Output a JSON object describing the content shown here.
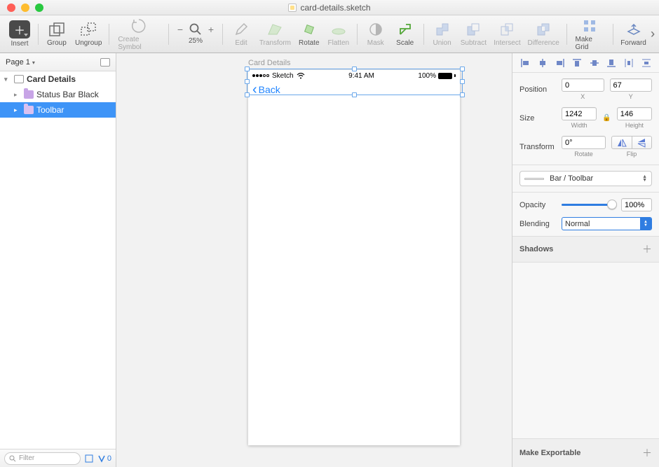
{
  "window": {
    "title": "card-details.sketch"
  },
  "toolbar": {
    "insert": "Insert",
    "group": "Group",
    "ungroup": "Ungroup",
    "create_symbol": "Create Symbol",
    "zoom_pct": "25%",
    "edit": "Edit",
    "transform": "Transform",
    "rotate": "Rotate",
    "flatten": "Flatten",
    "mask": "Mask",
    "scale": "Scale",
    "union": "Union",
    "subtract": "Subtract",
    "intersect": "Intersect",
    "difference": "Difference",
    "make_grid": "Make Grid",
    "forward": "Forward"
  },
  "sidebar": {
    "page_label": "Page 1",
    "artboard": "Card Details",
    "layers": [
      {
        "name": "Status Bar Black"
      },
      {
        "name": "Toolbar"
      }
    ],
    "filter_placeholder": "Filter",
    "slice_count": "0"
  },
  "canvas": {
    "artboard_label": "Card Details",
    "status_carrier": "Sketch",
    "status_time": "9:41 AM",
    "status_batt": "100%",
    "back_label": "Back"
  },
  "inspector": {
    "position_label": "Position",
    "x": "0",
    "y": "67",
    "x_label": "X",
    "y_label": "Y",
    "size_label": "Size",
    "width": "1242",
    "height": "146",
    "w_label": "Width",
    "h_label": "Height",
    "transform_label": "Transform",
    "rotate": "0°",
    "rotate_label": "Rotate",
    "flip_label": "Flip",
    "symbol_name": "Bar / Toolbar",
    "opacity_label": "Opacity",
    "opacity_value": "100%",
    "blending_label": "Blending",
    "blending_value": "Normal",
    "shadows_label": "Shadows",
    "exportable_label": "Make Exportable"
  }
}
